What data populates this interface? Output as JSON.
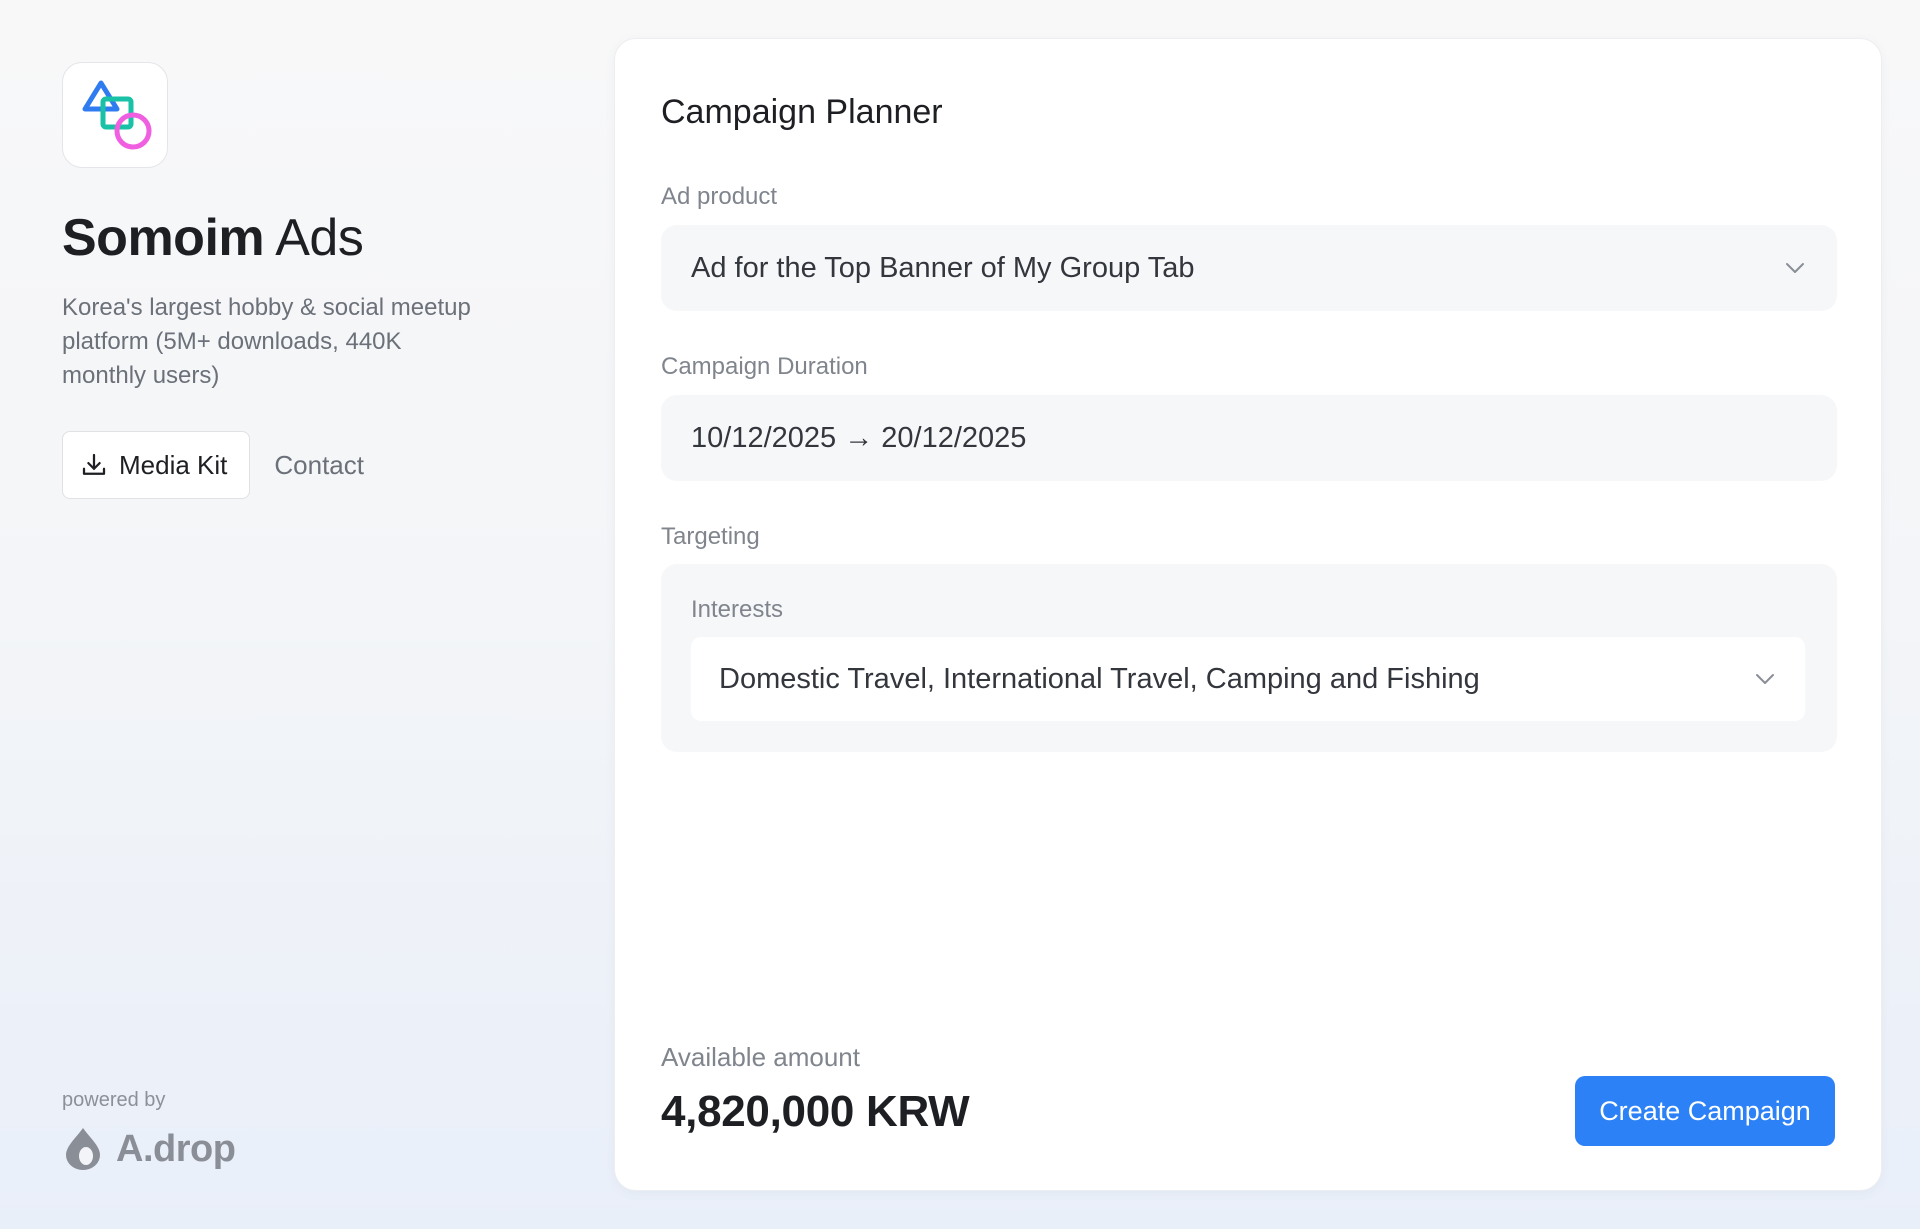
{
  "brand": {
    "name_bold": "Somoim",
    "name_light": " Ads",
    "description": "Korea's largest hobby & social meetup platform (5M+ downloads, 440K monthly users)",
    "logo_icon": "shapes-logo-icon"
  },
  "actions": {
    "media_kit_label": "Media Kit",
    "media_kit_icon": "download-icon",
    "contact_label": "Contact"
  },
  "footer": {
    "powered_by": "powered by",
    "partner_name": "A.drop",
    "partner_icon": "drop-icon"
  },
  "planner": {
    "title": "Campaign Planner",
    "ad_product": {
      "label": "Ad product",
      "value": "Ad for the Top Banner of My Group Tab"
    },
    "duration": {
      "label": "Campaign Duration",
      "value": "10/12/2025 → 20/12/2025"
    },
    "targeting": {
      "label": "Targeting",
      "interests_label": "Interests",
      "interests_value": "Domestic Travel, International Travel, Camping and Fishing"
    },
    "amount_label": "Available amount",
    "amount_value": "4,820,000 KRW",
    "create_button": "Create Campaign"
  },
  "colors": {
    "accent": "#2b81f5",
    "logo_blue": "#2f7cf0",
    "logo_green": "#19c2a6",
    "logo_pink": "#ef5fe0"
  }
}
